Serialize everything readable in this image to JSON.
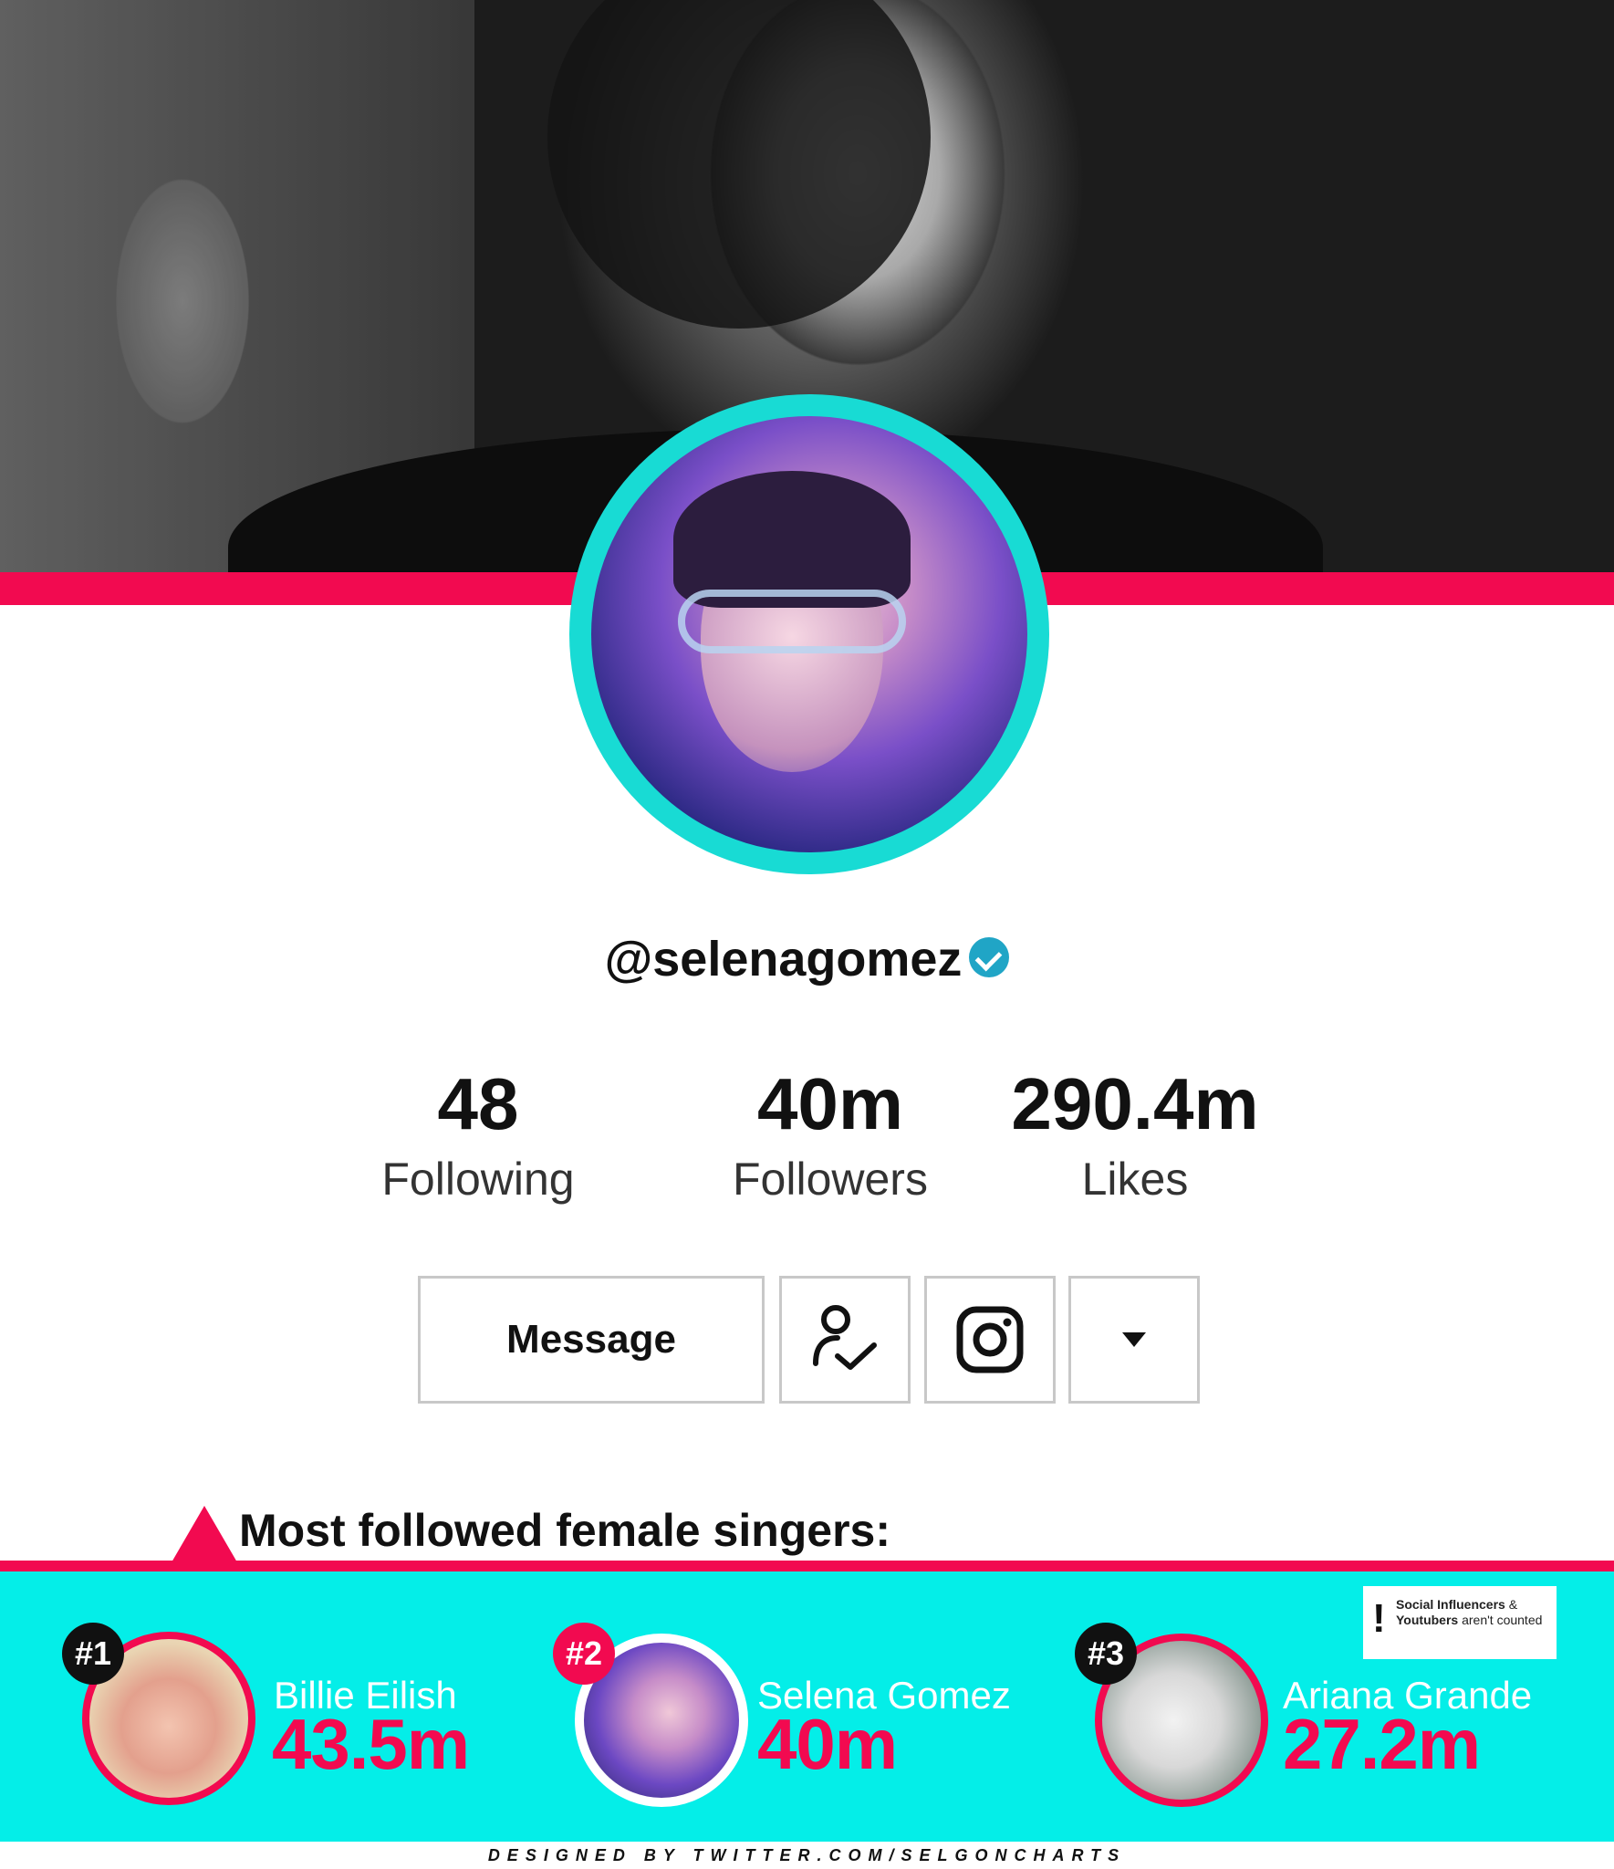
{
  "profile": {
    "username": "@selenagomez",
    "verified": true,
    "stats": [
      {
        "value": "48",
        "label": "Following"
      },
      {
        "value": "40m",
        "label": "Followers"
      },
      {
        "value": "290.4m",
        "label": "Likes"
      }
    ],
    "actions": {
      "message_label": "Message",
      "follow_icon": "user-check-icon",
      "instagram_icon": "instagram-icon",
      "more_icon": "caret-down-icon"
    }
  },
  "ranking": {
    "title": "Most followed female singers:",
    "entries": [
      {
        "rank": "#1",
        "name": "Billie Eilish",
        "followers": "43.5m"
      },
      {
        "rank": "#2",
        "name": "Selena Gomez",
        "followers": "40m"
      },
      {
        "rank": "#3",
        "name": "Ariana Grande",
        "followers": "27.2m"
      }
    ],
    "note": {
      "bold_part1": "Social Influencers",
      "part2": " & ",
      "bold_part3": "Youtubers",
      "part4": " aren't counted"
    }
  },
  "footer": {
    "credits": "DESIGNED BY TWITTER.COM/SELGONCHARTS"
  },
  "colors": {
    "accent_pink": "#f20a50",
    "accent_cyan": "#04eee8",
    "verified_blue": "#20a5c6"
  }
}
